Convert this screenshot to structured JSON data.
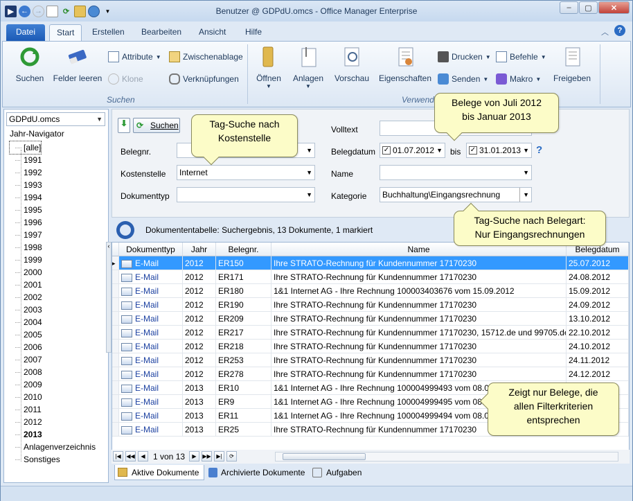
{
  "window": {
    "title": "Benutzer @ GDPdU.omcs - Office Manager Enterprise",
    "minimize": "–",
    "maximize": "▢",
    "close": "✕"
  },
  "tabs": {
    "file": "Datei",
    "start": "Start",
    "erstellen": "Erstellen",
    "bearbeiten": "Bearbeiten",
    "ansicht": "Ansicht",
    "hilfe": "Hilfe"
  },
  "ribbon": {
    "suchen": "Suchen",
    "felder_leeren": "Felder leeren",
    "attribute": "Attribute",
    "klone": "Klone",
    "zwischenablage": "Zwischenablage",
    "verknuepfungen": "Verknüpfungen",
    "group_suchen": "Suchen",
    "oeffnen": "Öffnen",
    "anlagen": "Anlagen",
    "vorschau": "Vorschau",
    "eigenschaften": "Eigenschaften",
    "drucken": "Drucken",
    "senden": "Senden",
    "befehle": "Befehle",
    "makro": "Makro",
    "freigeben": "Freigeben",
    "group_verwenden": "Verwend"
  },
  "left": {
    "db": "GDPdU.omcs",
    "nav_title": "Jahr-Navigator",
    "items": [
      "[alle]",
      "1991",
      "1992",
      "1993",
      "1994",
      "1995",
      "1996",
      "1997",
      "1998",
      "1999",
      "2000",
      "2001",
      "2002",
      "2003",
      "2004",
      "2005",
      "2006",
      "2007",
      "2008",
      "2009",
      "2010",
      "2011",
      "2012",
      "2013",
      "Anlagenverzeichnis",
      "Sonstiges"
    ]
  },
  "search": {
    "button": "Suchen",
    "belegnr_label": "Belegnr.",
    "kostenstelle_label": "Kostenstelle",
    "kostenstelle_value": "Internet",
    "dokumenttyp_label": "Dokumenttyp",
    "volltext_label": "Volltext",
    "belegdatum_label": "Belegdatum",
    "date_from": "01.07.2012",
    "bis": "bis",
    "date_to": "31.01.2013",
    "name_label": "Name",
    "kategorie_label": "Kategorie",
    "kategorie_value": "Buchhaltung\\Eingangsrechnung",
    "help": "?"
  },
  "table": {
    "caption": "Dokumententabelle: Suchergebnis, 13 Dokumente, 1 markiert",
    "headers": [
      "Dokumenttyp",
      "Jahr",
      "Belegnr.",
      "Name",
      "Belegdatum"
    ],
    "rows": [
      [
        "E-Mail",
        "2012",
        "ER150",
        "Ihre STRATO-Rechnung für Kundennummer 17170230",
        "25.07.2012"
      ],
      [
        "E-Mail",
        "2012",
        "ER171",
        "Ihre STRATO-Rechnung für Kundennummer 17170230",
        "24.08.2012"
      ],
      [
        "E-Mail",
        "2012",
        "ER180",
        "1&1 Internet AG - Ihre Rechnung 100003403676 vom 15.09.2012",
        "15.09.2012"
      ],
      [
        "E-Mail",
        "2012",
        "ER190",
        "Ihre STRATO-Rechnung für Kundennummer 17170230",
        "24.09.2012"
      ],
      [
        "E-Mail",
        "2012",
        "ER209",
        "Ihre STRATO-Rechnung für Kundennummer 17170230",
        "13.10.2012"
      ],
      [
        "E-Mail",
        "2012",
        "ER217",
        "Ihre STRATO-Rechnung für Kundennummer 17170230, 15712.de und 99705.de",
        "22.10.2012"
      ],
      [
        "E-Mail",
        "2012",
        "ER218",
        "Ihre STRATO-Rechnung für Kundennummer 17170230",
        "24.10.2012"
      ],
      [
        "E-Mail",
        "2012",
        "ER253",
        "Ihre STRATO-Rechnung für Kundennummer 17170230",
        "24.11.2012"
      ],
      [
        "E-Mail",
        "2012",
        "ER278",
        "Ihre STRATO-Rechnung für Kundennummer 17170230",
        "24.12.2012"
      ],
      [
        "E-Mail",
        "2013",
        "ER10",
        "1&1 Internet AG - Ihre Rechnung 100004999493 vom 08.01.2013",
        ""
      ],
      [
        "E-Mail",
        "2013",
        "ER9",
        "1&1 Internet AG - Ihre Rechnung 100004999495 vom 08.01.2013",
        ""
      ],
      [
        "E-Mail",
        "2013",
        "ER11",
        "1&1 Internet AG - Ihre Rechnung 100004999494 vom 08.01.2013",
        ""
      ],
      [
        "E-Mail",
        "2013",
        "ER25",
        "Ihre STRATO-Rechnung für Kundennummer 17170230",
        ""
      ]
    ],
    "pager": "1 von 13"
  },
  "bottom_tabs": {
    "aktive": "Aktive Dokumente",
    "archiviert": "Archivierte Dokumente",
    "aufgaben": "Aufgaben"
  },
  "callouts": {
    "kostenstelle": "Tag-Suche nach Kostenstelle",
    "datum": "Belege von Juli 2012 bis Januar 2013",
    "belegart": "Tag-Suche nach Belegart: Nur Eingangsrechnungen",
    "filter": "Zeigt nur Belege, die allen Filterkriterien entsprechen"
  }
}
